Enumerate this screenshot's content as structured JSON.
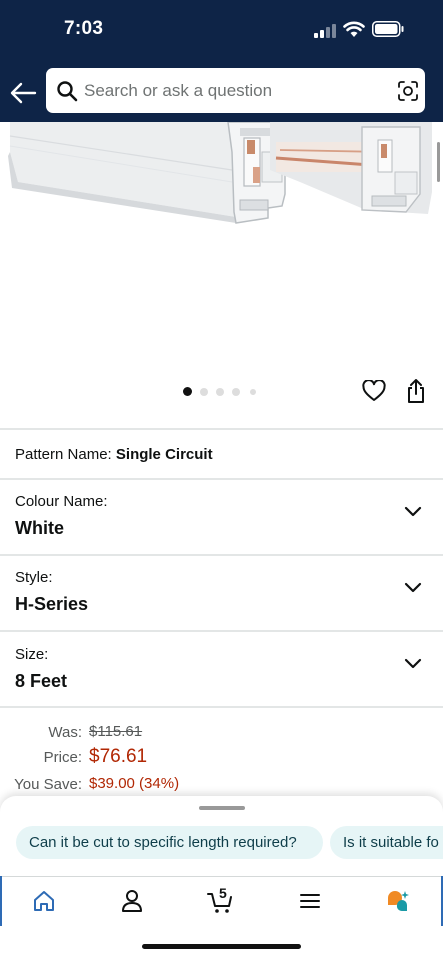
{
  "status": {
    "time": "7:03"
  },
  "search": {
    "placeholder": "Search or ask a question"
  },
  "carousel": {
    "count": 5,
    "active": 0
  },
  "pattern": {
    "label": "Pattern Name:",
    "value": "Single Circuit"
  },
  "colour": {
    "label": "Colour Name:",
    "value": "White"
  },
  "style": {
    "label": "Style:",
    "value": "H-Series"
  },
  "size": {
    "label": "Size:",
    "value": "8 Feet"
  },
  "pricing": {
    "was_label": "Was:",
    "was_value": "$115.61",
    "price_label": "Price:",
    "price_value": "$76.61",
    "save_label": "You Save:",
    "save_value": "$39.00 (34%)"
  },
  "suggestions": [
    "Can it be cut to specific length required?",
    "Is it suitable fo"
  ],
  "nav": {
    "items": [
      "home-icon",
      "account-icon",
      "cart-icon",
      "menu-icon",
      "rufus-icon"
    ],
    "cart_count": "5"
  },
  "colors": {
    "header_bg": "#0e2447",
    "price_red": "#b12704",
    "chip_bg": "#e6f5f6",
    "nav_accent": "#2e6bb5"
  },
  "icons": [
    "back-arrow-icon",
    "search-icon",
    "camera-icon",
    "heart-icon",
    "share-icon",
    "chevron-down-icon"
  ]
}
